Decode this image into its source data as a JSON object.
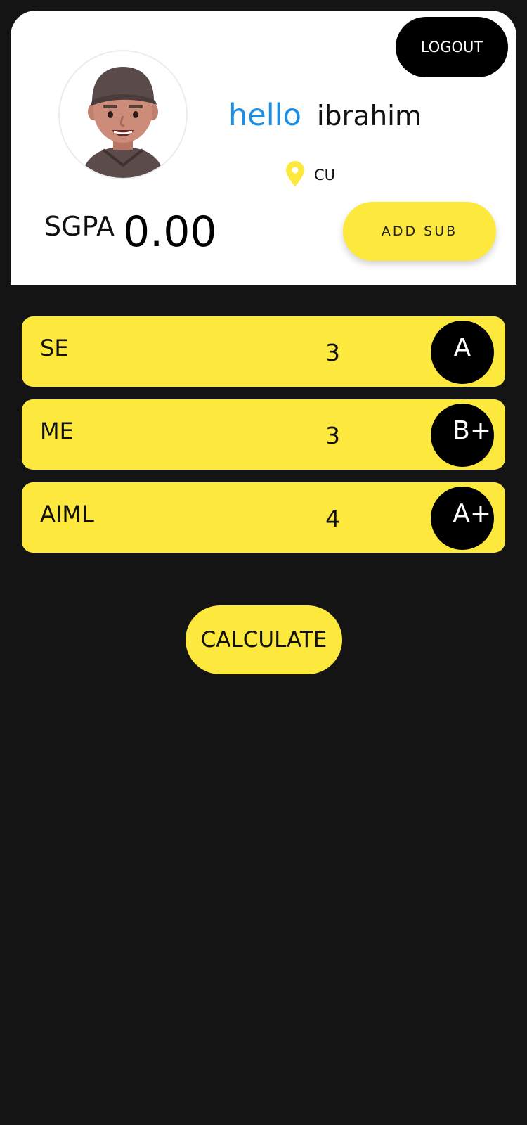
{
  "header": {
    "logout_label": "LOGOUT",
    "greeting_word": "hello",
    "user_name": "ibrahim",
    "location_icon": "location-pin-icon",
    "location": "CU",
    "sgpa_label": "SGPA",
    "sgpa_value": "0.00",
    "add_sub_label": "ADD SUB",
    "avatar_icon": "avatar-image"
  },
  "subjects": [
    {
      "name": "SE",
      "credits": "3",
      "grade": "A"
    },
    {
      "name": "ME",
      "credits": "3",
      "grade": "B+"
    },
    {
      "name": "AIML",
      "credits": "4",
      "grade": "A+"
    }
  ],
  "actions": {
    "calculate_label": "CALCULATE"
  },
  "colors": {
    "background": "#141414",
    "accent_yellow": "#fde93d",
    "greeting_blue": "#1e8ee3",
    "black": "#000000",
    "white": "#ffffff"
  }
}
